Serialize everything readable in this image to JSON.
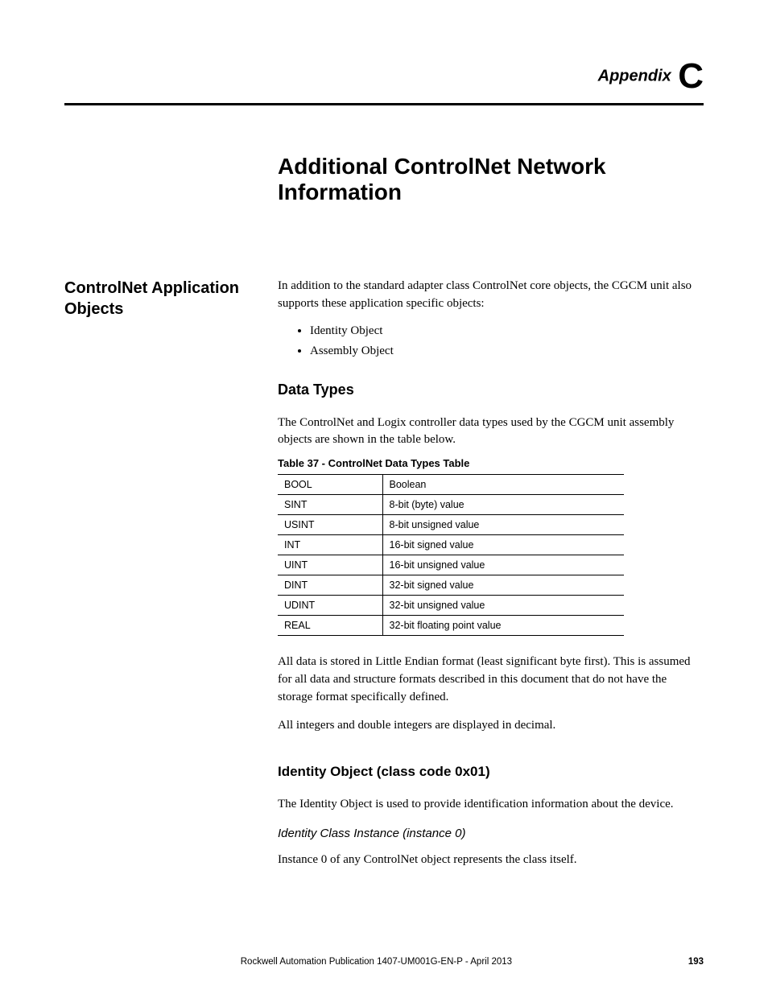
{
  "header": {
    "appendix_word": "Appendix",
    "appendix_letter": "C"
  },
  "chapter_title": "Additional ControlNet Network Information",
  "sidebar": {
    "heading": "ControlNet Application Objects"
  },
  "intro": {
    "p1": "In addition to the standard adapter class ControlNet core objects, the CGCM unit also supports these application specific objects:",
    "bullets": [
      "Identity Object",
      "Assembly Object"
    ]
  },
  "data_types": {
    "heading": "Data Types",
    "p1": "The ControlNet and Logix controller data types used by the CGCM unit assembly objects are shown in the table below.",
    "table_caption": "Table 37 - ControlNet Data Types Table",
    "rows": [
      {
        "name": "BOOL",
        "desc": "Boolean"
      },
      {
        "name": "SINT",
        "desc": "8-bit (byte) value"
      },
      {
        "name": "USINT",
        "desc": "8-bit unsigned value"
      },
      {
        "name": "INT",
        "desc": "16-bit signed value"
      },
      {
        "name": "UINT",
        "desc": "16-bit unsigned value"
      },
      {
        "name": "DINT",
        "desc": "32-bit signed value"
      },
      {
        "name": "UDINT",
        "desc": "32-bit unsigned value"
      },
      {
        "name": "REAL",
        "desc": "32-bit floating point value"
      }
    ],
    "p2": "All data is stored in Little Endian format (least significant byte first). This is assumed for all data and structure formats described in this document that do not have the storage format specifically defined.",
    "p3": "All integers and double integers are displayed in decimal."
  },
  "identity": {
    "heading": "Identity Object (class code 0x01)",
    "p1": "The Identity Object is used to provide identification information about the device.",
    "sub_heading": "Identity Class Instance (instance 0)",
    "p2": "Instance 0 of any ControlNet object represents the class itself."
  },
  "footer": {
    "center": "Rockwell Automation Publication 1407-UM001G-EN-P - April 2013",
    "page": "193"
  }
}
